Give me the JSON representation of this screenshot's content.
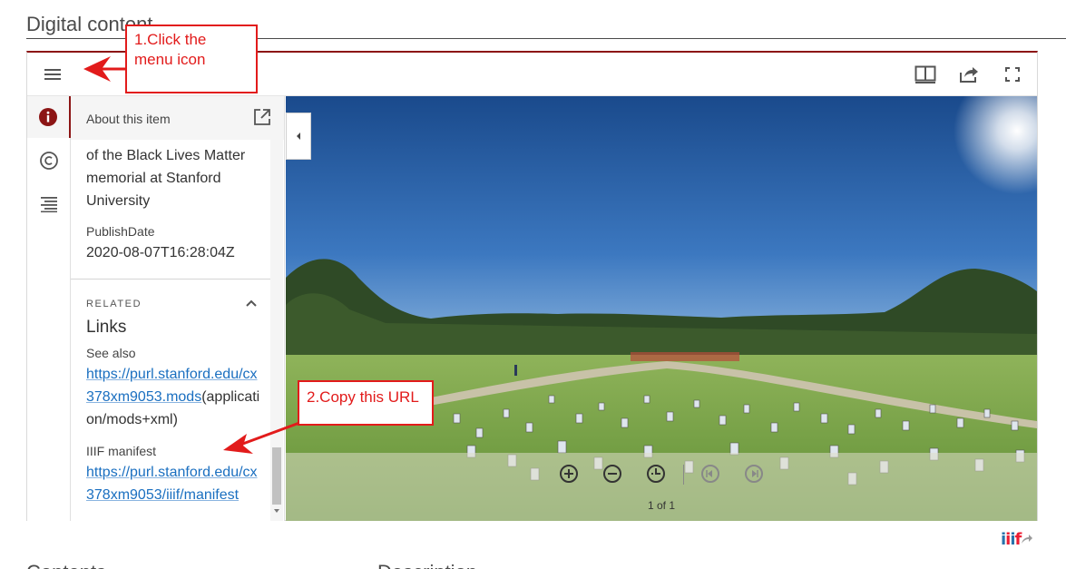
{
  "section": {
    "title": "Digital content"
  },
  "topbar": {
    "menu_icon": "hamburger-menu-icon",
    "book_view_icon": "book-view-icon",
    "share_icon": "share-icon",
    "fullscreen_icon": "fullscreen-icon"
  },
  "rail": {
    "items": [
      {
        "icon": "info-icon",
        "active": true
      },
      {
        "icon": "copyright-icon",
        "active": false
      },
      {
        "icon": "table-of-contents-icon",
        "active": false
      }
    ]
  },
  "panel": {
    "title": "About this item",
    "popout_icon": "open-in-new-icon",
    "description_lines": [
      "of the Black Lives Matter",
      "memorial at Stanford",
      "University"
    ],
    "publish_date_label": "PublishDate",
    "publish_date_value": "2020-08-07T16:28:04Z",
    "related_label": "RELATED",
    "links_title": "Links",
    "see_also_label": "See also",
    "mods_link_line1": "https://purl.stanford.edu/cx",
    "mods_link_line2": "378xm9053.mods",
    "mods_suffix_line2": "(applicati",
    "mods_suffix_line3": "on/mods+xml)",
    "iiif_label": "IIIF manifest",
    "iiif_link_line1": "https://purl.stanford.edu/cx",
    "iiif_link_line2": "378xm9053/iiif/manifest"
  },
  "controls": {
    "zoom_in_icon": "zoom-in-icon",
    "zoom_out_icon": "zoom-out-icon",
    "reset_icon": "reset-zoom-icon",
    "prev_icon": "previous-page-icon",
    "next_icon": "next-page-icon",
    "page_count": "1 of 1"
  },
  "logo": {
    "text": "iiif"
  },
  "bottom": {
    "left_heading": "Contents",
    "right_heading": "Description"
  },
  "annotations": {
    "callout1_line1": "1.Click the",
    "callout1_line2": "menu icon",
    "callout2": "2.Copy this URL"
  },
  "colors": {
    "accent": "#8c1515",
    "link": "#1a6fc0",
    "annotation": "#e21b1b"
  }
}
